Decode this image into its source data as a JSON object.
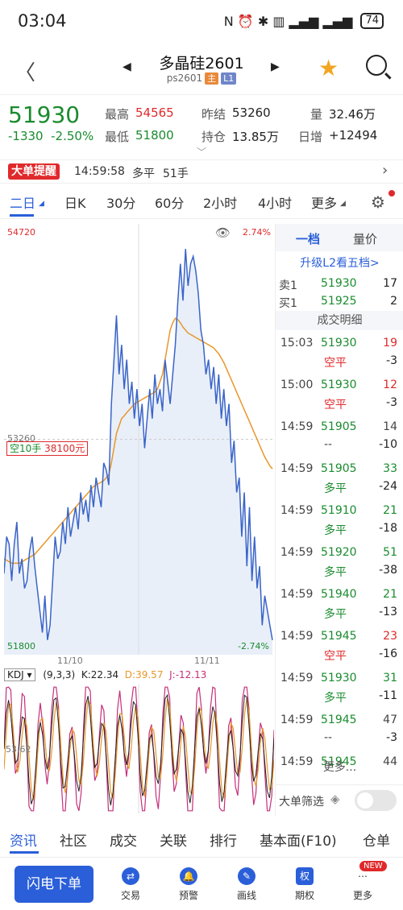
{
  "status": {
    "time": "03:04",
    "battery": "74",
    "icons": "N ⏰ ✱ ▥ ▂▄▆ ▂▄▆"
  },
  "header": {
    "title": "多晶硅2601",
    "code": "ps2601",
    "tag_main": "主",
    "tag_level": "L1"
  },
  "quote": {
    "price": "51930",
    "change": "-1330",
    "change_pct": "-2.50%",
    "high_label": "最高",
    "high": "54565",
    "low_label": "最低",
    "low": "51800",
    "prev_label": "昨结",
    "prev": "53260",
    "oi_label": "持仓",
    "oi": "13.85万",
    "vol_label": "量",
    "vol": "32.46万",
    "daily_label": "日增",
    "daily": "+12494"
  },
  "alert": {
    "badge": "大单提醒",
    "time": "14:59:58",
    "type": "多平",
    "qty": "51手"
  },
  "tabs": [
    "二日",
    "日K",
    "30分",
    "60分",
    "2小时",
    "4小时",
    "更多"
  ],
  "chart": {
    "top_price": "54720",
    "top_pct": "2.74%",
    "bottom_price": "51800",
    "bottom_pct": "-2.74%",
    "ref_price": "53260",
    "marker": "空10手",
    "marker_value": "38100元",
    "date1": "11/10",
    "date2": "11/11",
    "colors": {
      "price_line": "#3a64c8",
      "avg_line": "#e8972a",
      "fill": "#e9eff9"
    }
  },
  "chart_data": {
    "type": "line",
    "ylim": [
      51800,
      54720
    ],
    "series": [],
    "price": [
      52350,
      52600,
      52550,
      52300,
      52550,
      52700,
      52350,
      52450,
      52250,
      52300,
      52500,
      52600,
      52400,
      52250,
      52100,
      51950,
      52200,
      51900,
      52000,
      52300,
      52600,
      52450,
      52500,
      52700,
      52550,
      52800,
      52600,
      52700,
      52800,
      52650,
      52900,
      52750,
      52850,
      52700,
      52950,
      52800,
      53000,
      52900,
      52800,
      53100,
      53050,
      52950,
      53500,
      53800,
      54100,
      53700,
      53900,
      53600,
      53800,
      53500,
      53650,
      53400,
      53600,
      53350,
      53500,
      53200,
      53400,
      53600,
      53400,
      53700,
      53500,
      53600,
      53450,
      53800,
      53650,
      53500,
      53700,
      53900,
      54200,
      54450,
      54200,
      54550,
      54300,
      54450,
      54500,
      54400,
      54250,
      54000,
      53900,
      53700,
      53800,
      53600,
      53750,
      53500,
      53700,
      53400,
      53600,
      53350,
      53500,
      53100,
      53250,
      52900,
      53000,
      52600,
      52900,
      52400,
      52800,
      52300,
      52600,
      52250,
      52400,
      52000,
      52200,
      52100,
      52000,
      51900
    ],
    "avg": [
      52450,
      52440,
      52430,
      52420,
      52420,
      52420,
      52420,
      52430,
      52440,
      52450,
      52460,
      52470,
      52480,
      52500,
      52520,
      52540,
      52560,
      52580,
      52600,
      52620,
      52640,
      52660,
      52680,
      52700,
      52720,
      52740,
      52760,
      52780,
      52800,
      52820,
      52840,
      52860,
      52880,
      52900,
      52920,
      52940,
      52950,
      52960,
      52970,
      52980,
      53000,
      53020,
      53100,
      53200,
      53300,
      53350,
      53400,
      53420,
      53440,
      53460,
      53480,
      53500,
      53510,
      53520,
      53530,
      53540,
      53550,
      53560,
      53570,
      53580,
      53600,
      53650,
      53700,
      53800,
      53900,
      54000,
      54050,
      54080,
      54070,
      54050,
      54020,
      54000,
      53980,
      53970,
      53960,
      53950,
      53940,
      53930,
      53920,
      53910,
      53900,
      53890,
      53880,
      53860,
      53840,
      53810,
      53780,
      53740,
      53700,
      53660,
      53620,
      53580,
      53540,
      53500,
      53460,
      53420,
      53380,
      53340,
      53300,
      53260,
      53220,
      53180,
      53140,
      53110,
      53080,
      53060
    ],
    "kdj": {
      "params": "(9,3,3)",
      "K": "22.34",
      "D": "39.57",
      "J": "-12.13",
      "ref": "53.62"
    }
  },
  "right_panel": {
    "tab1": "一档",
    "tab2": "量价",
    "upgrade": "升级L2看五档>",
    "ask_label": "卖1",
    "ask_price": "51930",
    "ask_vol": "17",
    "bid_label": "买1",
    "bid_price": "51925",
    "bid_vol": "2",
    "detail_title": "成交明细",
    "trades": [
      {
        "time": "15:03",
        "price": "51930",
        "vol": "19",
        "type": "空平",
        "oi": "-3"
      },
      {
        "time": "15:00",
        "price": "51930",
        "vol": "12",
        "type": "空平",
        "oi": "-3"
      },
      {
        "time": "14:59",
        "price": "51905",
        "vol": "14",
        "type": "--",
        "oi": "-10"
      },
      {
        "time": "14:59",
        "price": "51905",
        "vol": "33",
        "type": "多平",
        "oi": "-24"
      },
      {
        "time": "14:59",
        "price": "51910",
        "vol": "21",
        "type": "多平",
        "oi": "-18"
      },
      {
        "time": "14:59",
        "price": "51920",
        "vol": "51",
        "type": "多平",
        "oi": "-38"
      },
      {
        "time": "14:59",
        "price": "51940",
        "vol": "21",
        "type": "多平",
        "oi": "-13"
      },
      {
        "time": "14:59",
        "price": "51945",
        "vol": "23",
        "type": "空平",
        "oi": "-16"
      },
      {
        "time": "14:59",
        "price": "51930",
        "vol": "31",
        "type": "多平",
        "oi": "-11"
      },
      {
        "time": "14:59",
        "price": "51945",
        "vol": "47",
        "type": "--",
        "oi": "-3"
      },
      {
        "time": "14:59",
        "price": "51945",
        "vol": "44",
        "type": "",
        "oi": ""
      }
    ],
    "more": "更多...",
    "filter": "大单筛选"
  },
  "info_tabs": [
    "资讯",
    "社区",
    "成交",
    "关联",
    "排行",
    "基本面(F10)",
    "仓单"
  ],
  "bottom": {
    "flash": "闪电下单",
    "trade": "交易",
    "alert": "预警",
    "draw": "画线",
    "option": "期权",
    "more": "更多",
    "new": "NEW"
  }
}
